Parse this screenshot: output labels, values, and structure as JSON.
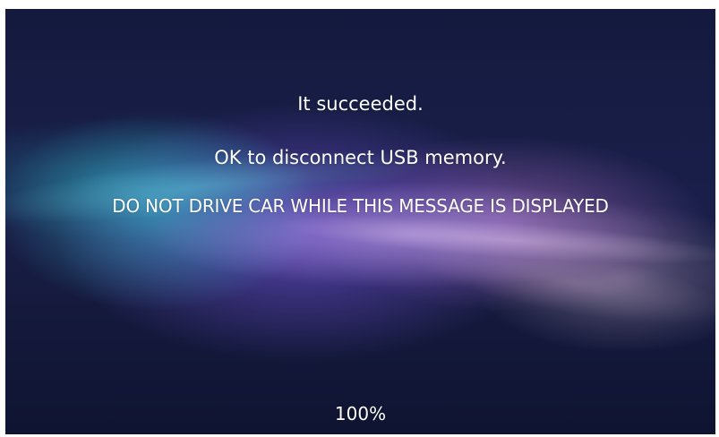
{
  "dialog": {
    "status_line": "It succeeded.",
    "instruction_line": "OK to disconnect USB memory.",
    "warning_line": "DO NOT DRIVE CAR WHILE THIS MESSAGE IS DISPLAYED",
    "progress_text": "100%"
  },
  "progress": {
    "percent": 100
  },
  "colors": {
    "background_dark": "#141a3e",
    "glow_purple": "#6e50d2",
    "glow_cyan": "#3cc8dc",
    "text": "#ffffff"
  }
}
